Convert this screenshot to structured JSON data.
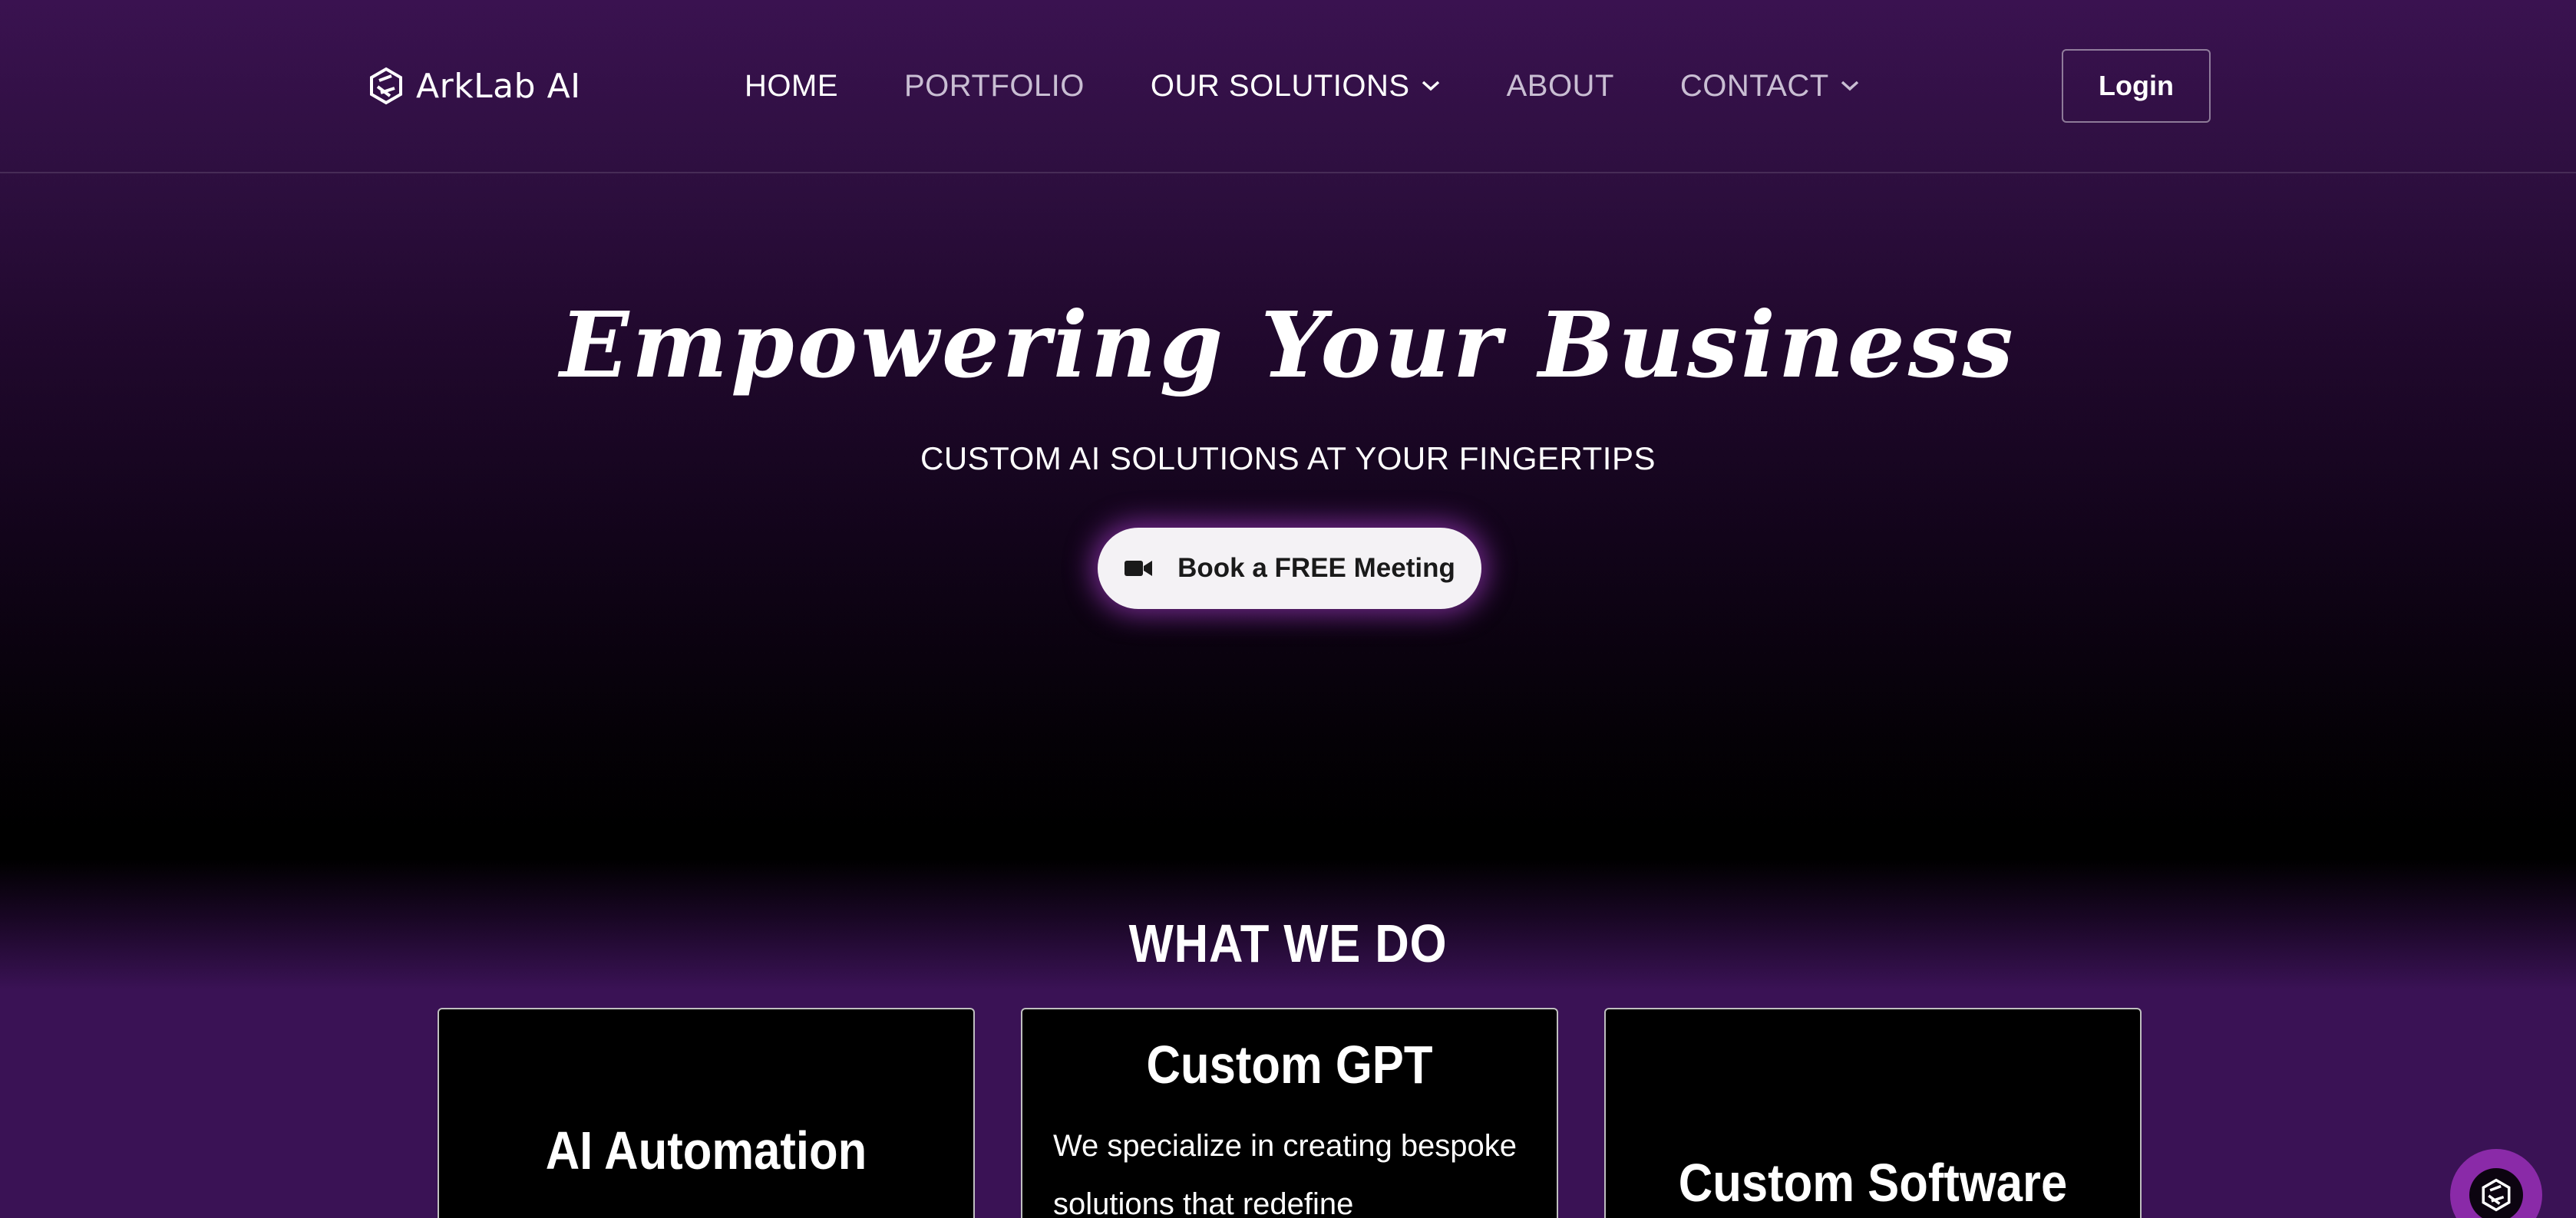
{
  "header": {
    "logo_text": "ArkLab AI",
    "logo_icon": "arklab-logo-icon",
    "nav": [
      {
        "label": "HOME",
        "has_dropdown": false,
        "style": "active"
      },
      {
        "label": "PORTFOLIO",
        "has_dropdown": false,
        "style": "muted"
      },
      {
        "label": "OUR SOLUTIONS",
        "has_dropdown": true,
        "style": "active"
      },
      {
        "label": "ABOUT",
        "has_dropdown": false,
        "style": "muted"
      },
      {
        "label": "CONTACT",
        "has_dropdown": true,
        "style": "muted"
      }
    ],
    "login_label": "Login"
  },
  "hero": {
    "title": "Empowering Your Business",
    "subtitle": "CUSTOM AI SOLUTIONS AT YOUR FINGERTIPS",
    "cta_label": "Book a FREE Meeting",
    "cta_icon": "video-camera-icon"
  },
  "services": {
    "section_title": "WHAT WE DO",
    "cards": [
      {
        "title": "AI Automation",
        "body": ""
      },
      {
        "title": "Custom GPT",
        "body": "We specialize in creating bespoke solutions that redefine"
      },
      {
        "title": "Custom Software",
        "body": ""
      }
    ]
  },
  "chat_widget": {
    "icon": "arklab-logo-icon"
  },
  "colors": {
    "background_top": "#3a1250",
    "background_mid": "#000000",
    "accent_glow": "#be46e6",
    "chat_widget": "#8a2aa8",
    "cta_background": "#f4f2f5"
  }
}
